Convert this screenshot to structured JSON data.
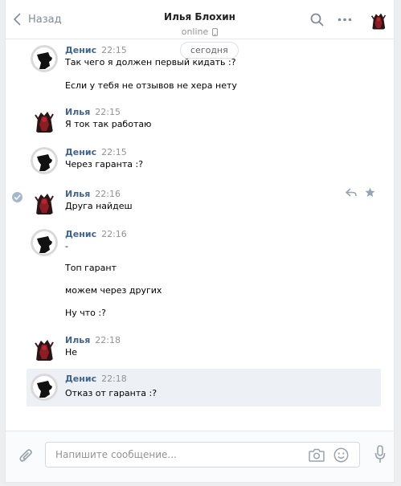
{
  "header": {
    "back_label": "Назад",
    "contact_name": "Илья Блохин",
    "status": "online"
  },
  "date_separator": "сегодня",
  "messages": [
    {
      "author": "Денис",
      "time": "22:15",
      "lines": [
        "Так чего я должен первый кидать :?",
        "Если у тебя не отзывов не хера нету"
      ]
    },
    {
      "author": "Илья",
      "time": "22:15",
      "lines": [
        "Я ток так работаю"
      ]
    },
    {
      "author": "Денис",
      "time": "22:15",
      "lines": [
        "Через гаранта :?"
      ]
    },
    {
      "author": "Илья",
      "time": "22:16",
      "lines": [
        "Друга найдеш"
      ]
    },
    {
      "author": "Денис",
      "time": "22:16",
      "lines": [
        "-",
        "Топ гарант",
        "можем через других",
        "Ну что :?"
      ]
    },
    {
      "author": "Илья",
      "time": "22:18",
      "lines": [
        "Не"
      ]
    },
    {
      "author": "Денис",
      "time": "22:18",
      "lines": [
        "Отказ от гаранта :?"
      ]
    }
  ],
  "composer": {
    "placeholder": "Напишите сообщение..."
  },
  "colors": {
    "author": "#42648b",
    "time": "#939393",
    "highlight": "#edf0f5",
    "accent": "#828a99"
  },
  "icons": [
    "chevron-left-icon",
    "search-icon",
    "more-icon",
    "phone-icon",
    "reply-icon",
    "star-icon",
    "check-icon",
    "paperclip-icon",
    "camera-icon",
    "smile-icon",
    "microphone-icon"
  ]
}
